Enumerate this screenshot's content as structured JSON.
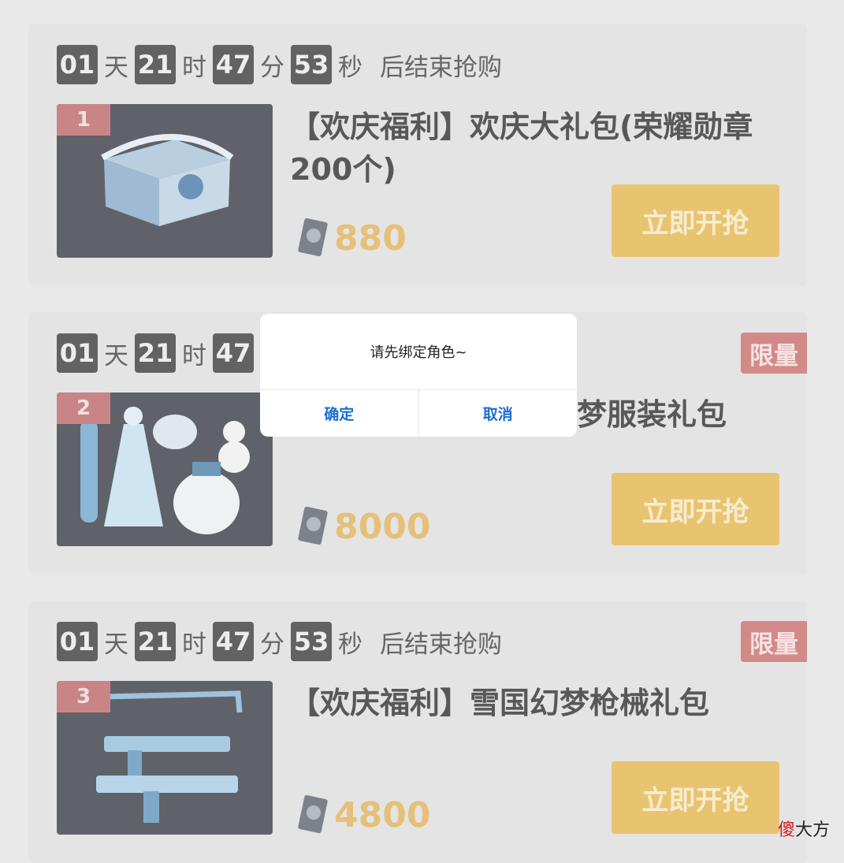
{
  "items": [
    {
      "countdown": {
        "days": "01",
        "day_unit": "天",
        "hours": "21",
        "hour_unit": "时",
        "minutes": "47",
        "minute_unit": "分",
        "seconds": "53",
        "second_unit": "秒",
        "suffix": "后结束抢购"
      },
      "rank": "1",
      "title": "【欢庆福利】欢庆大礼包(荣耀勋章200个)",
      "price": "880",
      "buy_label": "立即开抢",
      "limited": ""
    },
    {
      "countdown": {
        "days": "01",
        "day_unit": "天",
        "hours": "21",
        "hour_unit": "时",
        "minutes": "47",
        "minute_unit": "",
        "seconds": "",
        "second_unit": "",
        "suffix": ""
      },
      "rank": "2",
      "title": "梦服装礼包",
      "price": "8000",
      "buy_label": "立即开抢",
      "limited": "限量"
    },
    {
      "countdown": {
        "days": "01",
        "day_unit": "天",
        "hours": "21",
        "hour_unit": "时",
        "minutes": "47",
        "minute_unit": "分",
        "seconds": "53",
        "second_unit": "秒",
        "suffix": "后结束抢购"
      },
      "rank": "3",
      "title": "【欢庆福利】雪国幻梦枪械礼包",
      "price": "4800",
      "buy_label": "立即开抢",
      "limited": "限量"
    }
  ],
  "dialog": {
    "message": "请先绑定角色~",
    "confirm_label": "确定",
    "cancel_label": "取消"
  },
  "watermark": {
    "part1": "傻",
    "part2": "大方"
  },
  "colors": {
    "accent_button": "#e9c470",
    "price": "#e4c07a",
    "rank_badge": "#c98585",
    "limited_badge": "#d28a88",
    "dialog_link": "#1b6fd1"
  },
  "icons": {
    "price_currency": "coin-icon"
  }
}
